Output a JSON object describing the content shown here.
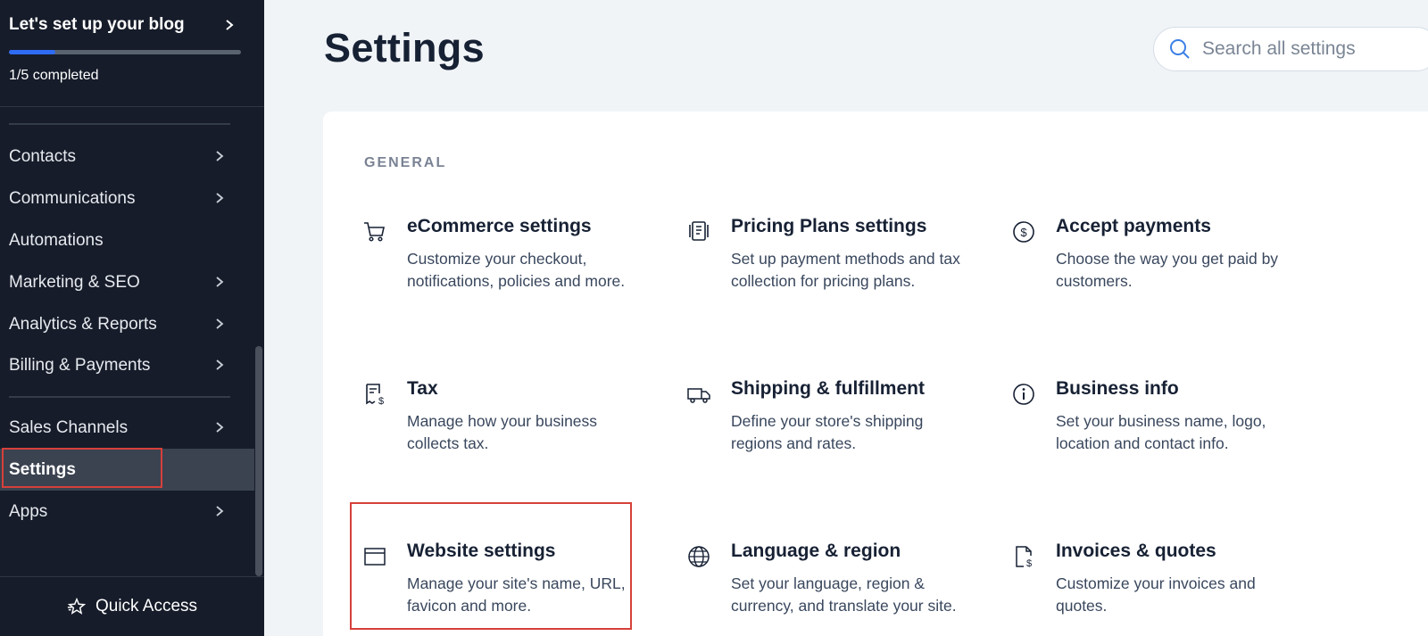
{
  "setup": {
    "title": "Let's set up your blog",
    "progress_percent": 20,
    "status": "1/5 completed"
  },
  "nav": {
    "items": [
      {
        "label": "Contacts",
        "has_submenu": true
      },
      {
        "label": "Communications",
        "has_submenu": true
      },
      {
        "label": "Automations",
        "has_submenu": false
      },
      {
        "label": "Marketing & SEO",
        "has_submenu": true
      },
      {
        "label": "Analytics & Reports",
        "has_submenu": true
      },
      {
        "label": "Billing & Payments",
        "has_submenu": true
      },
      {
        "label": "Sales Channels",
        "has_submenu": true
      },
      {
        "label": "Settings",
        "has_submenu": false,
        "active": true
      },
      {
        "label": "Apps",
        "has_submenu": true
      }
    ],
    "quick_access": "Quick Access"
  },
  "main": {
    "title": "Settings",
    "search_placeholder": "Search all settings",
    "section_label": "GENERAL",
    "tiles": [
      {
        "icon": "cart-icon",
        "title": "eCommerce settings",
        "desc": "Customize your checkout, notifications, policies and more."
      },
      {
        "icon": "pricing-plans-icon",
        "title": "Pricing Plans settings",
        "desc": "Set up payment methods and tax collection for pricing plans."
      },
      {
        "icon": "dollar-circle-icon",
        "title": "Accept payments",
        "desc": "Choose the way you get paid by customers."
      },
      {
        "icon": "tax-receipt-icon",
        "title": "Tax",
        "desc": "Manage how your business collects tax."
      },
      {
        "icon": "truck-icon",
        "title": "Shipping & fulfillment",
        "desc": "Define your store's shipping regions and rates."
      },
      {
        "icon": "info-icon",
        "title": "Business info",
        "desc": "Set your business name, logo, location and contact info."
      },
      {
        "icon": "browser-window-icon",
        "title": "Website settings",
        "desc": "Manage your site's name, URL, favicon and more."
      },
      {
        "icon": "globe-icon",
        "title": "Language & region",
        "desc": "Set your language, region & currency, and translate your site."
      },
      {
        "icon": "invoice-icon",
        "title": "Invoices & quotes",
        "desc": "Customize your invoices and quotes."
      }
    ]
  },
  "colors": {
    "sidebar_bg": "#161c2a",
    "accent_blue": "#2f6cf6",
    "highlight_red": "#d6403a",
    "text_dark": "#172134"
  }
}
